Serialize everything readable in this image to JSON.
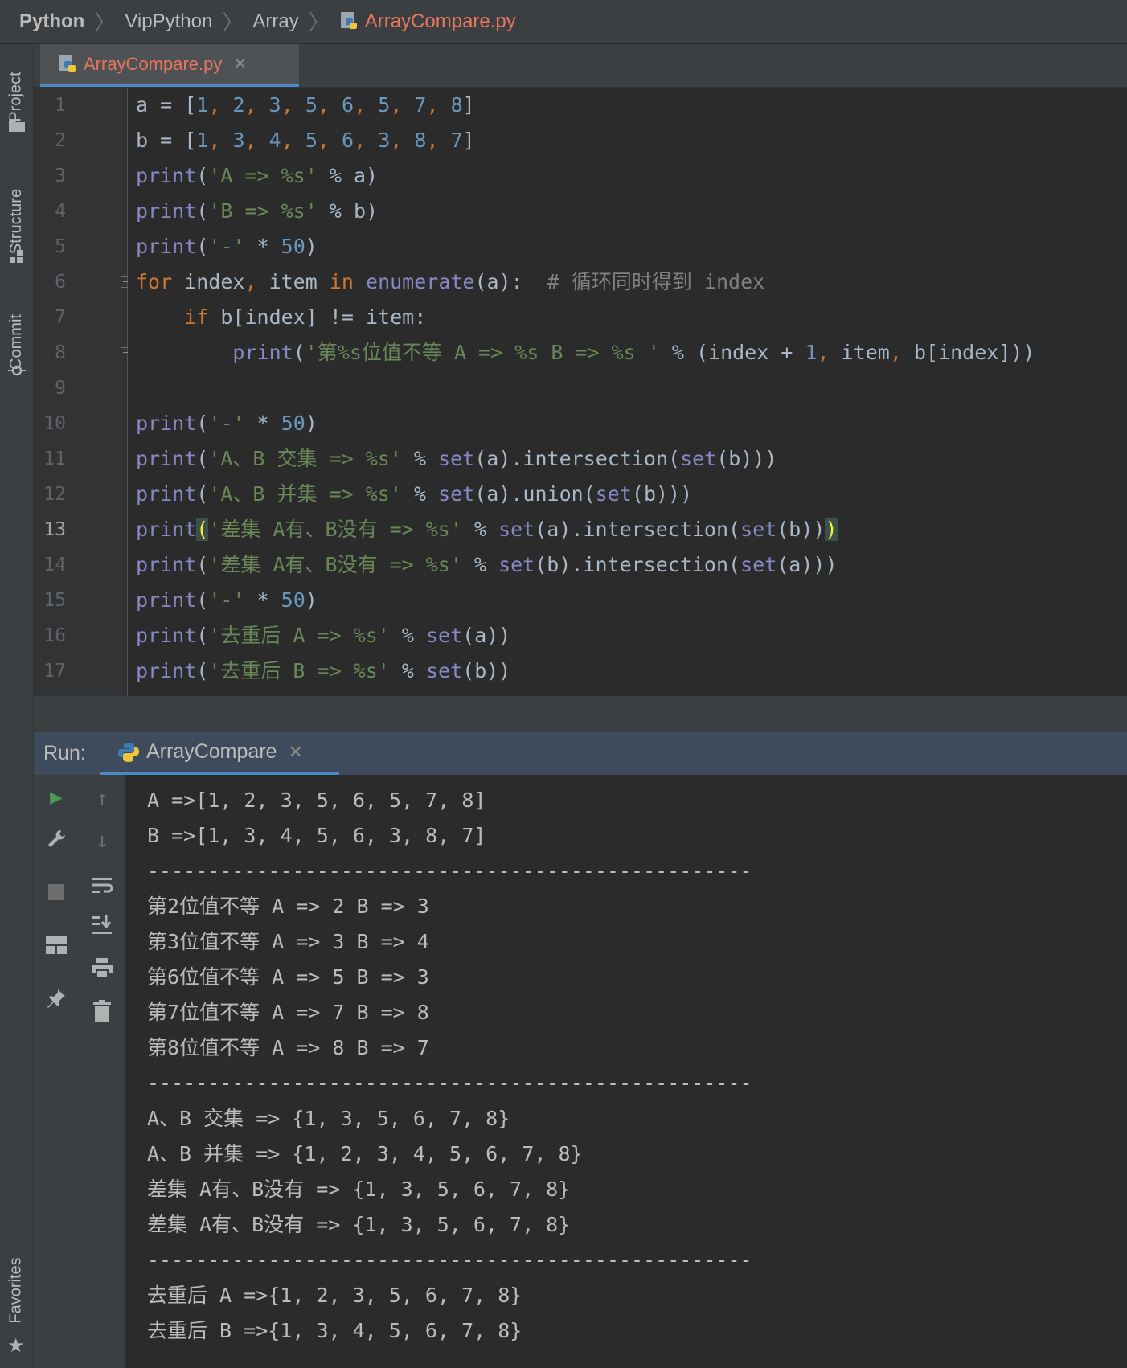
{
  "breadcrumb": [
    "Python",
    "VipPython",
    "Array",
    "ArrayCompare.py"
  ],
  "left_strip": [
    "Project",
    "Structure",
    "Commit",
    "Favorites"
  ],
  "editor": {
    "tab_name": "ArrayCompare.py",
    "current_line": 13,
    "line_numbers": [
      "1",
      "2",
      "3",
      "4",
      "5",
      "6",
      "7",
      "8",
      "9",
      "10",
      "11",
      "12",
      "13",
      "14",
      "15",
      "16",
      "17"
    ]
  },
  "code_lines": [
    "a = [1, 2, 3, 5, 6, 5, 7, 8]",
    "b = [1, 3, 4, 5, 6, 3, 8, 7]",
    "print('A => %s' % a)",
    "print('B => %s' % b)",
    "print('-' * 50)",
    "for index, item in enumerate(a):  # 循环同时得到 index",
    "    if b[index] != item:",
    "        print('第%s位值不等 A => %s B => %s ' % (index + 1, item, b[index]))",
    "",
    "print('-' * 50)",
    "print('A、B 交集 => %s' % set(a).intersection(set(b)))",
    "print('A、B 并集 => %s' % set(a).union(set(b)))",
    "print('差集 A有、B没有 => %s' % set(a).intersection(set(b)))",
    "print('差集 A有、B没有 => %s' % set(b).intersection(set(a)))",
    "print('-' * 50)",
    "print('去重后 A => %s' % set(a))",
    "print('去重后 B => %s' % set(b))"
  ],
  "run": {
    "label": "Run:",
    "tab_name": "ArrayCompare",
    "output": [
      "A =>[1, 2, 3, 5, 6, 5, 7, 8]",
      "B =>[1, 3, 4, 5, 6, 3, 8, 7]",
      "--------------------------------------------------",
      "第2位值不等 A => 2 B => 3",
      "第3位值不等 A => 3 B => 4",
      "第6位值不等 A => 5 B => 3",
      "第7位值不等 A => 7 B => 8",
      "第8位值不等 A => 8 B => 7",
      "--------------------------------------------------",
      "A、B 交集 => {1, 3, 5, 6, 7, 8}",
      "A、B 并集 => {1, 2, 3, 4, 5, 6, 7, 8}",
      "差集 A有、B没有 => {1, 3, 5, 6, 7, 8}",
      "差集 A有、B没有 => {1, 3, 5, 6, 7, 8}",
      "--------------------------------------------------",
      "去重后 A =>{1, 2, 3, 5, 6, 7, 8}",
      "去重后 B =>{1, 3, 4, 5, 6, 7, 8}"
    ]
  },
  "colors": {
    "keyword": "#cc7832",
    "builtin": "#8888c6",
    "string": "#6a8759",
    "number": "#6897bb",
    "comment": "#808080",
    "file_tab": "#e8765d"
  }
}
